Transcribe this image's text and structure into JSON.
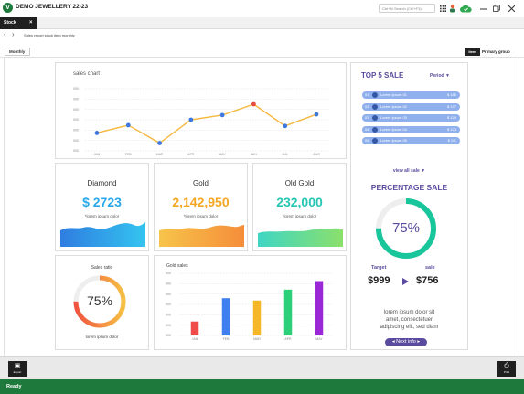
{
  "app": {
    "title": "DEMO JEWELLERY 22-23",
    "logo_letter": "V",
    "menu_search_placeholder": "Ctrl+M Search (Ctrl+F3)"
  },
  "tabs": [
    {
      "label": "Stock",
      "close": "×"
    }
  ],
  "breadcrumb": "Sales report stock item monthly",
  "filter": {
    "period_label": "Monthly"
  },
  "view_toggle": {
    "active": "Item",
    "inactive": "Primary group"
  },
  "sales_chart": {
    "title": "sales chart",
    "chart_data": {
      "type": "line",
      "title": "sales chart",
      "categories": [
        "JAN",
        "FEB",
        "MAR",
        "APR",
        "MAY",
        "JUN",
        "JUL",
        "AUG"
      ],
      "values": [
        23,
        33,
        10,
        40,
        46,
        60,
        32,
        47
      ],
      "ylim": [
        0,
        80
      ],
      "ytick_labels": [
        "000",
        "000",
        "000",
        "000",
        "000",
        "000",
        "000"
      ],
      "line_color": "#f5b83d",
      "point_color": "#3f78dc",
      "highlight_color": "#e64b3b",
      "highlight_index": 5,
      "grid": true
    }
  },
  "stats": [
    {
      "title": "Diamond",
      "value": "$ 2723",
      "sub": "*lorem ipsum dolor",
      "color": "#29a9ec"
    },
    {
      "title": "Gold",
      "value": "2,142,950",
      "sub": "*lorem ipsum dolor",
      "color": "#f5a623"
    },
    {
      "title": "Old Gold",
      "value": "232,000",
      "sub": "*lorem ipsum dolor",
      "color": "#26c6b3"
    }
  ],
  "sales_ratio": {
    "title": "Sales ratio",
    "value_text": "75%",
    "value": 0.75,
    "sub": "lorem ipsum dolor"
  },
  "gold_sales": {
    "title": "Gold sales",
    "chart_data": {
      "type": "bar",
      "title": "Gold sales",
      "categories": [
        "JAN",
        "FEB",
        "MAR",
        "APR",
        "MAY"
      ],
      "values": [
        18,
        48,
        45,
        59,
        70
      ],
      "colors": [
        "#ef4b4b",
        "#3f7ff0",
        "#f5b62a",
        "#2ecf79",
        "#9b28d6"
      ],
      "ylim": [
        0,
        80
      ],
      "ytick_labels": [
        "000",
        "000",
        "000",
        "000",
        "000",
        "000",
        "000"
      ],
      "grid": true
    }
  },
  "top5": {
    "title": "TOP 5 SALE",
    "period_label": "Period ▼",
    "rows": [
      {
        "rank": "01",
        "name": "Lorem Ipsum 01",
        "price": "$ 155"
      },
      {
        "rank": "02",
        "name": "Lorem Ipsum 02",
        "price": "$ 137"
      },
      {
        "rank": "03",
        "name": "Lorem Ipsum 03",
        "price": "$ 129"
      },
      {
        "rank": "04",
        "name": "Lorem Ipsum 04",
        "price": "$ 123"
      },
      {
        "rank": "05",
        "name": "Lorem Ipsum 05",
        "price": "$ 111"
      }
    ],
    "view_all": "view all sale ▼"
  },
  "percentage": {
    "title": "PERCENTAGE SALE",
    "value_text": "75%",
    "value": 0.75,
    "target_label": "Target",
    "sale_label": "sale",
    "target_value": "$999",
    "sale_value": "$756",
    "desc_lines": [
      "lorem ipsum dolor sit",
      "amet, consectetuer",
      "adipiscing elit, sed diam"
    ],
    "next_label": "Next info"
  },
  "bottom": {
    "left_button": "Export",
    "right_button": "Print"
  },
  "status": "Ready",
  "colors": {
    "accent_purple": "#5b4b9e",
    "green": "#1e7a3c",
    "teal": "#19c69b"
  }
}
